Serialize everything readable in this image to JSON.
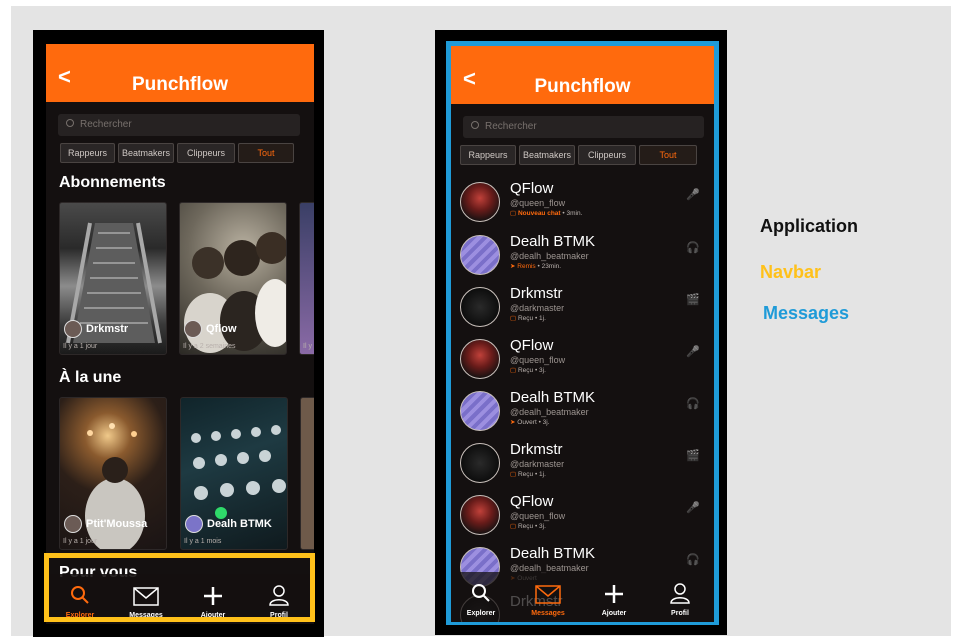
{
  "app": {
    "title": "Punchflow",
    "back_glyph": "<"
  },
  "search": {
    "placeholder": "Rechercher"
  },
  "filters": [
    "Rappeurs",
    "Beatmakers",
    "Clippeurs",
    "Tout"
  ],
  "filters_active_index": 3,
  "home": {
    "subscriptions_title": "Abonnements",
    "subscriptions": [
      {
        "name": "Drkmstr",
        "time": "Il y a 1 jour"
      },
      {
        "name": "Qflow",
        "time": "Il y a 2 semaines"
      },
      {
        "name": "",
        "time": "Il y"
      }
    ],
    "featured_title": "À la une",
    "featured": [
      {
        "name": "Ptit'Moussa",
        "time": "Il y a 1 jour"
      },
      {
        "name": "Dealh BTMK",
        "time": "Il y a 1 mois"
      }
    ],
    "for_you_title": "Pour vous"
  },
  "navbar": {
    "items": [
      {
        "label": "Explorer",
        "icon": "search-icon"
      },
      {
        "label": "Messages",
        "icon": "mail-icon"
      },
      {
        "label": "Ajouter",
        "icon": "plus-icon"
      },
      {
        "label": "Profil",
        "icon": "user-icon"
      }
    ],
    "active_left": 0,
    "active_right": 1
  },
  "messages": [
    {
      "name": "QFlow",
      "handle": "@queen_flow",
      "kind": "Nouveau chat",
      "time": "• 3min.",
      "role": "mic-icon"
    },
    {
      "name": "Dealh BTMK",
      "handle": "@dealh_beatmaker",
      "kind": "Remis",
      "time": "• 23min.",
      "role": "headphones-icon"
    },
    {
      "name": "Drkmstr",
      "handle": "@darkmaster",
      "kind": "Reçu",
      "time": "• 1j.",
      "role": "clapper-icon"
    },
    {
      "name": "QFlow",
      "handle": "@queen_flow",
      "kind": "Reçu",
      "time": "• 3j.",
      "role": "mic-icon"
    },
    {
      "name": "Dealh BTMK",
      "handle": "@dealh_beatmaker",
      "kind": "Ouvert",
      "time": "• 3j.",
      "role": "headphones-icon"
    },
    {
      "name": "Drkmstr",
      "handle": "@darkmaster",
      "kind": "Reçu",
      "time": "• 1j.",
      "role": "clapper-icon"
    },
    {
      "name": "QFlow",
      "handle": "@queen_flow",
      "kind": "Reçu",
      "time": "• 3j.",
      "role": "mic-icon"
    },
    {
      "name": "Dealh BTMK",
      "handle": "@dealh_beatmaker",
      "kind": "Ouvert",
      "time": "",
      "role": "headphones-icon"
    },
    {
      "name": "Drkmstr",
      "handle": "",
      "kind": "",
      "time": "",
      "role": ""
    }
  ],
  "legend": {
    "application": "Application",
    "navbar": "Navbar",
    "messages": "Messages"
  },
  "colors": {
    "accent": "#ff6a0d",
    "background": "#141010",
    "navbar_highlight": "#ffc11a",
    "messages_highlight": "#1f9bd8"
  }
}
